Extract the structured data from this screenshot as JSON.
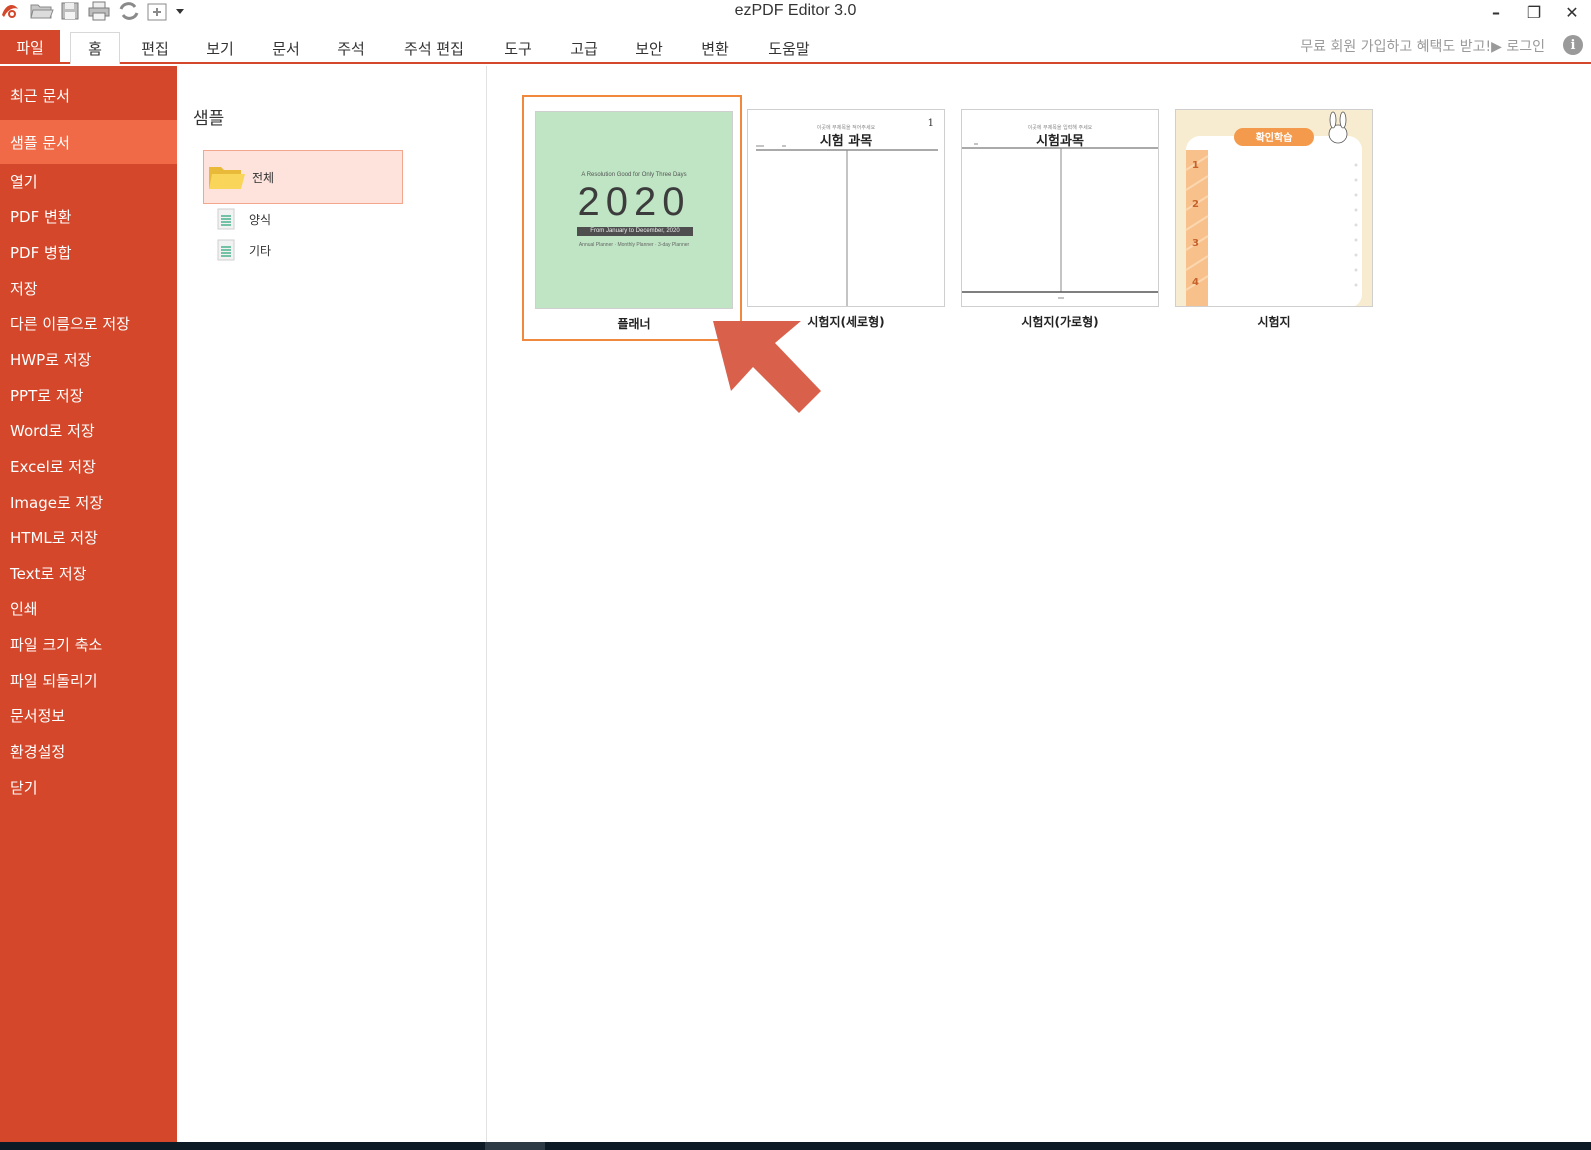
{
  "window": {
    "title": "ezPDF Editor 3.0",
    "minimize_glyph": "–",
    "restore_glyph": "❐",
    "close_glyph": "✕"
  },
  "quick_access": {
    "icons": [
      "app-logo-icon",
      "open-folder-icon",
      "save-icon",
      "print-icon",
      "convert-icon",
      "new-page-icon",
      "dropdown-arrow-icon"
    ]
  },
  "ribbon": {
    "file_tab": "파일",
    "tabs": [
      {
        "label": "홈",
        "active": true
      },
      {
        "label": "편집"
      },
      {
        "label": "보기"
      },
      {
        "label": "문서"
      },
      {
        "label": "주석"
      },
      {
        "label": "주석 편집"
      },
      {
        "label": "도구"
      },
      {
        "label": "고급"
      },
      {
        "label": "보안"
      },
      {
        "label": "변환"
      },
      {
        "label": "도움말"
      }
    ],
    "promo": "무료 회원 가입하고 혜택도 받고!▶ 로그인",
    "info_glyph": "i"
  },
  "sidebar": {
    "items": [
      {
        "label": "최근 문서"
      },
      {
        "label": "샘플 문서",
        "active": true
      },
      {
        "label": "열기"
      },
      {
        "label": "PDF 변환"
      },
      {
        "label": "PDF 병합"
      },
      {
        "label": "저장"
      },
      {
        "label": "다른 이름으로 저장"
      },
      {
        "label": "HWP로 저장"
      },
      {
        "label": "PPT로 저장"
      },
      {
        "label": "Word로 저장"
      },
      {
        "label": "Excel로 저장"
      },
      {
        "label": "Image로 저장"
      },
      {
        "label": "HTML로 저장"
      },
      {
        "label": "Text로 저장"
      },
      {
        "label": "인쇄"
      },
      {
        "label": "파일 크기 축소"
      },
      {
        "label": "파일 되돌리기"
      },
      {
        "label": "문서정보"
      },
      {
        "label": "환경설정"
      },
      {
        "label": "닫기"
      }
    ]
  },
  "samples": {
    "title": "샘플",
    "folder_all": "전체",
    "categories": [
      {
        "label": "양식"
      },
      {
        "label": "기타"
      }
    ]
  },
  "thumbnails": [
    {
      "label": "플래너",
      "selected": true,
      "planner_subtitle": "A Resolution Good for Only Three Days",
      "planner_year": "2020",
      "planner_band": "From January to December, 2020",
      "planner_footer": "Annual Planner · Monthly Planner · 3-day Planner"
    },
    {
      "label": "시험지(세로형)",
      "exam_small": "이곳에 부제목을 적어주세요",
      "exam_title": "시험 과목",
      "exam_page": "1"
    },
    {
      "label": "시험지(가로형)",
      "exam_small": "이곳에 부제목을 입력해 주세요",
      "exam_title": "시험과목"
    },
    {
      "label": "시험지",
      "quiz_badge": "확인학습",
      "quiz_numbers": [
        "1",
        "2",
        "3",
        "4"
      ]
    }
  ],
  "colors": {
    "accent": "#d4472a",
    "sidebar_active": "#f06a47",
    "selection": "#f0883e",
    "pointer_arrow": "#d9604a",
    "planner_bg": "#bfe5c4",
    "quiz_bg": "#f7ecd0"
  }
}
